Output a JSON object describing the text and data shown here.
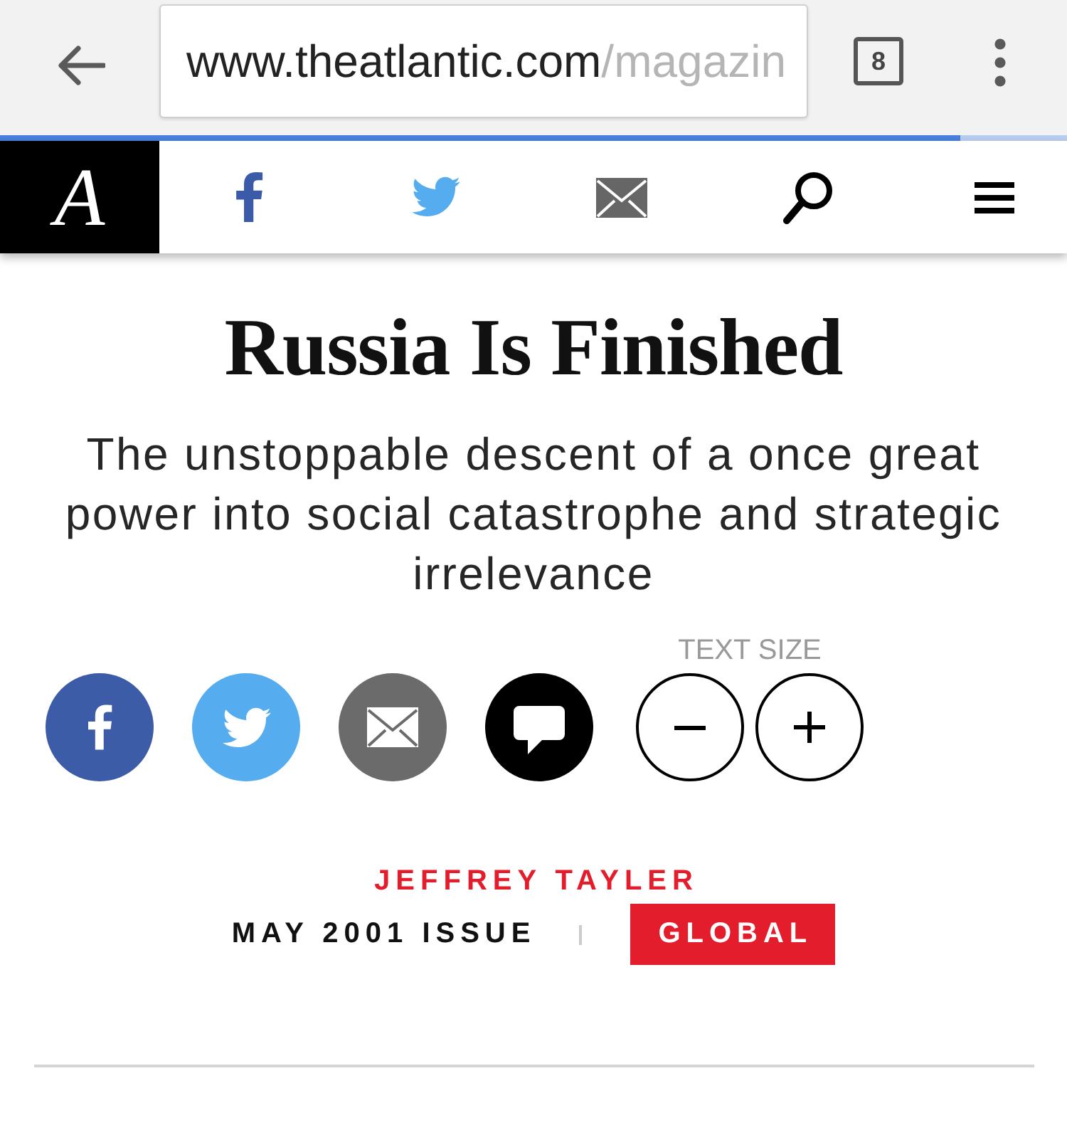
{
  "browser": {
    "url_host": "www.theatlantic.com",
    "url_path": "/magazin",
    "tab_count": "8",
    "load_progress": {
      "level": 0.9
    }
  },
  "site_header": {
    "logo": "A"
  },
  "article": {
    "title": "Russia Is Finished",
    "subtitle": "The unstoppable descent of a once great power into social catastrophe and strategic irrelevance",
    "text_size_label": "TEXT SIZE",
    "author": "JEFFREY TAYLER",
    "issue": "MAY 2001 ISSUE",
    "section_tag": "GLOBAL"
  }
}
